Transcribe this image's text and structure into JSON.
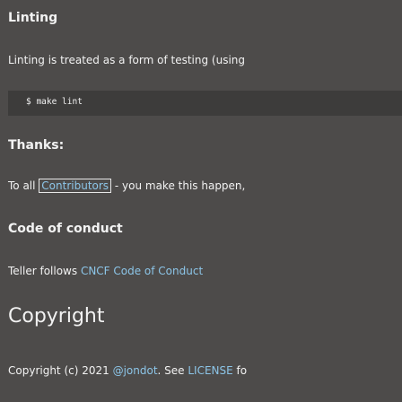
{
  "sections": {
    "linting_heading": "Linting",
    "linting_text": "Linting is treated as a form of testing (using",
    "code_line": "$ make lint",
    "thanks_heading": "Thanks:",
    "thanks_prefix": "To all ",
    "thanks_link": "Contributors",
    "thanks_suffix": " - you make this happen,",
    "conduct_heading": "Code of conduct",
    "conduct_prefix": "Teller follows ",
    "conduct_link": "CNCF Code of Conduct",
    "copyright_heading": "Copyright",
    "copyright_prefix": "Copyright (c) 2021 ",
    "copyright_link1": "@jondot",
    "copyright_mid": ". See ",
    "copyright_link2": "LICENSE",
    "copyright_suffix": " fo"
  }
}
